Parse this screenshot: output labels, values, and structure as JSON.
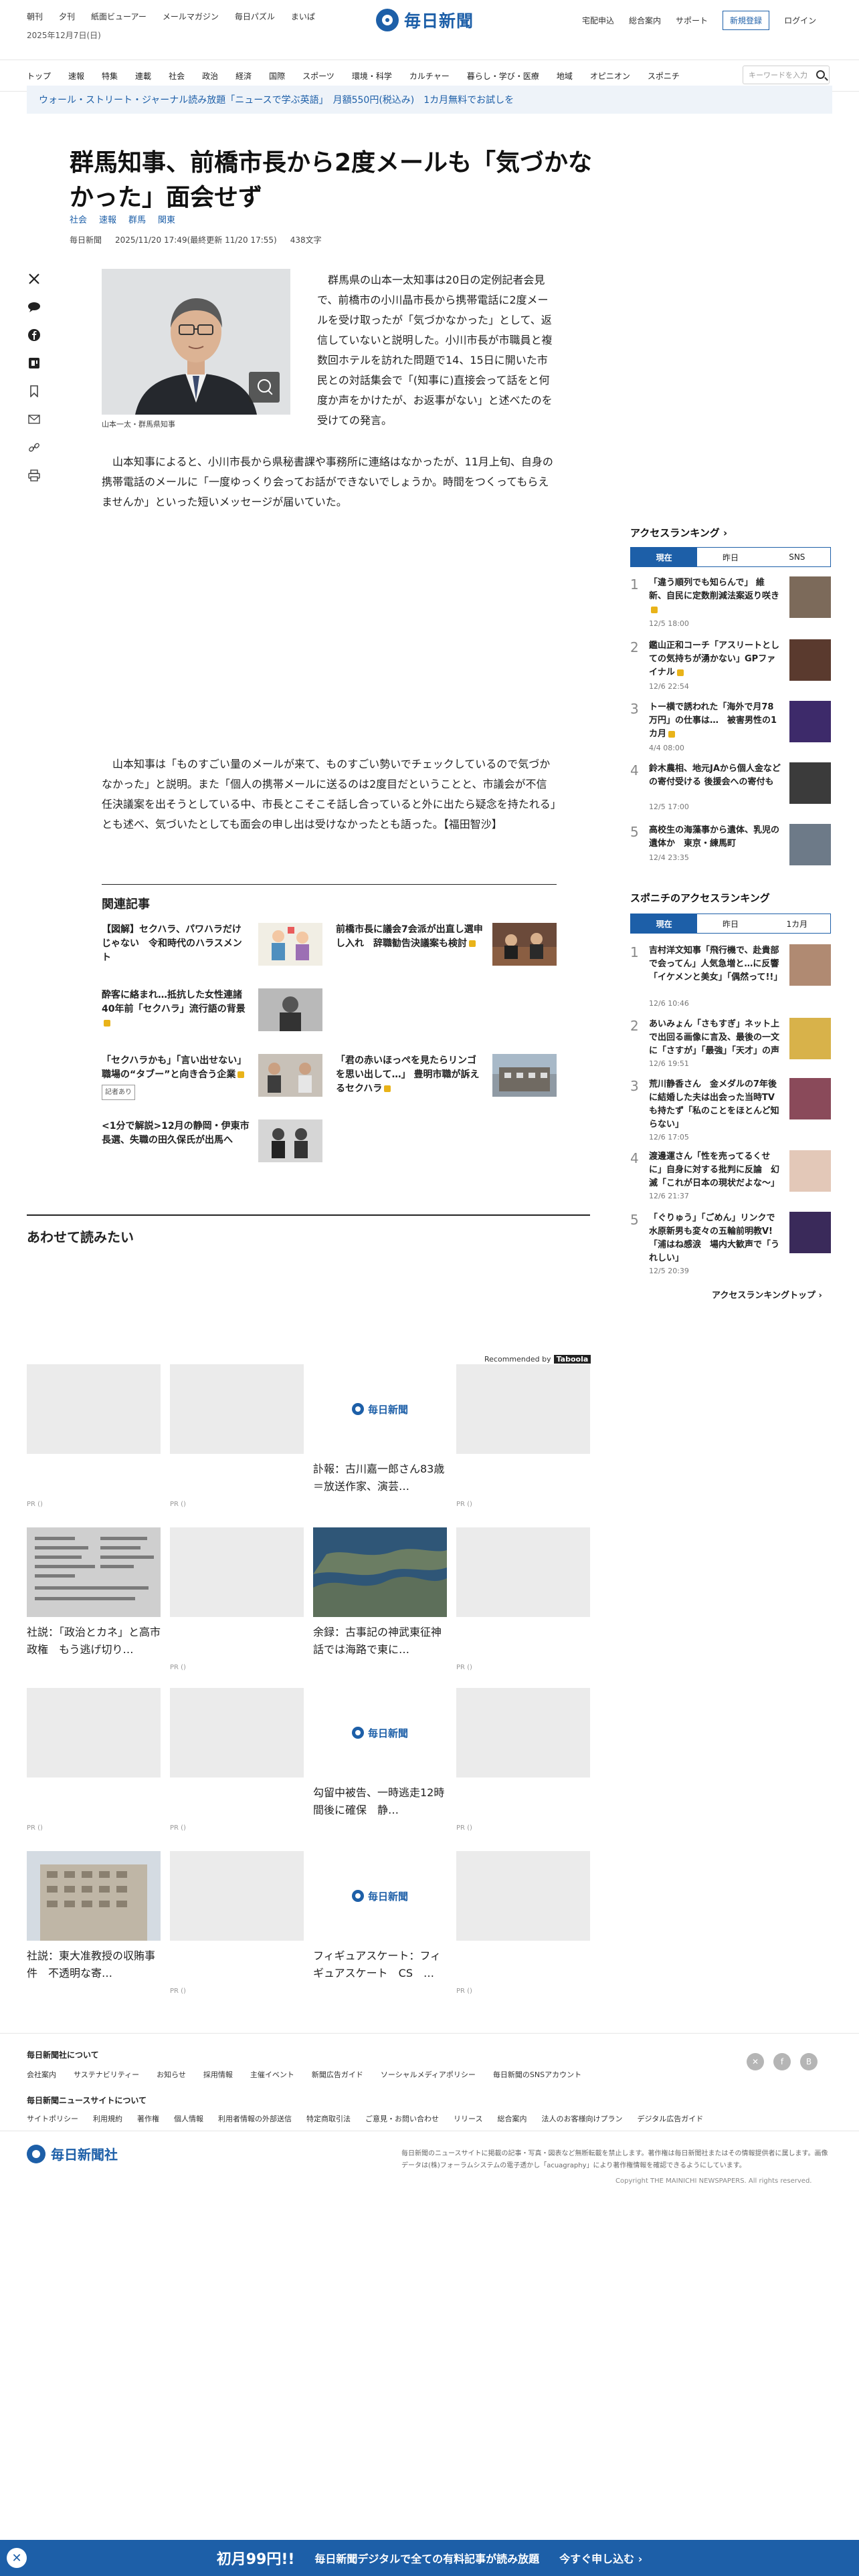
{
  "top": {
    "links": [
      "朝刊",
      "夕刊",
      "紙面ビューアー",
      "メールマガジン",
      "毎日パズル",
      "まいぱ"
    ],
    "date": "2025年12月7日(日)",
    "logo": "毎日新聞",
    "right_links": [
      "宅配申込",
      "総合案内",
      "サポート"
    ],
    "register": "新規登録",
    "login": "ログイン"
  },
  "nav": {
    "items": [
      "トップ",
      "速報",
      "特集",
      "連載",
      "社会",
      "政治",
      "経済",
      "国際",
      "スポーツ",
      "環境・科学",
      "カルチャー",
      "暮らし・学び・医療",
      "地域",
      "オピニオン",
      "スポニチ"
    ],
    "search_placeholder": "キーワードを入力"
  },
  "promo": "ウォール・ストリート・ジャーナル読み放題「ニュースで学ぶ英語」　月額550円(税込み)　1カ月無料でお試しを",
  "article": {
    "headline": "群馬知事、前橋市長から2度メールも「気づかなかった」面会せず",
    "tags": [
      "社会",
      "速報",
      "群馬",
      "関東"
    ],
    "meta": [
      "毎日新聞",
      "2025/11/20 17:49(最終更新 11/20 17:55)",
      "438文字"
    ],
    "caption": "山本一太・群馬県知事",
    "p1": "群馬県の山本一太知事は20日の定例記者会見で、前橋市の小川晶市長から携帯電話に2度メールを受け取ったが「気づかなかった」として、返信していないと説明した。小川市長が市職員と複数回ホテルを訪れた問題で14、15日に開いた市民との対話集会で「(知事に)直接会って話をと何度か声をかけたが、お返事がない」と述べたのを受けての発言。",
    "p2": "山本知事によると、小川市長から県秘書課や事務所に連絡はなかったが、11月上旬、自身の携帯電話のメールに「一度ゆっくり会ってお話ができないでしょうか。時間をつくってもらえませんか」といった短いメッセージが届いていた。",
    "p3": "山本知事は「ものすごい量のメールが来て、ものすごい勢いでチェックしているので気づかなかった」と説明。また「個人の携帯メールに送るのは2度目だということと、市議会が不信任決議案を出そうとしている中、市長とこそこそ話し合っていると外に出たら疑念を持たれる」とも述べ、気づいたとしても面会の申し出は受けなかったとも語った。【福田智沙】"
  },
  "related": {
    "title": "関連記事",
    "items": [
      {
        "text": "【図解】セクハラ、パワハラだけじゃない　令和時代のハラスメント",
        "locked": false,
        "badge": ""
      },
      {
        "text": "前橋市長に議会7会派が出直し選申し入れ　辞職勧告決議案も検討",
        "locked": true,
        "badge": ""
      },
      {
        "text": "酔客に絡まれ…抵抗した女性連諸　40年前「セクハラ」流行語の背景",
        "locked": true,
        "badge": ""
      },
      {
        "text": "「セクハラかも」「言い出せない」職場の“タブー”と向き合う企業",
        "locked": true,
        "badge": "記者あり"
      },
      {
        "text": "「君の赤いほっぺを見たらリンゴを思い出して…」 豊明市職が訴えるセクハラ",
        "locked": true,
        "badge": ""
      },
      {
        "text": "<1分で解説>12月の静岡・伊東市長選、失職の田久保氏が出馬へ",
        "locked": false,
        "badge": ""
      }
    ]
  },
  "read_together": {
    "title": "あわせて読みたい",
    "recommended": "Recommended by",
    "brand": "Taboola",
    "cards": [
      {
        "cap": "",
        "pr": "PR ()"
      },
      {
        "cap": "",
        "pr": "PR ()"
      },
      {
        "cap": "訃報：古川嘉一郎さん83歳＝放送作家、演芸…",
        "pr": ""
      },
      {
        "cap": "",
        "pr": "PR ()"
      },
      {
        "cap": "社説：「政治とカネ」と高市政権　もう逃げ切り…",
        "pr": ""
      },
      {
        "cap": "",
        "pr": "PR ()"
      },
      {
        "cap": "余録：古事記の神武東征神話では海路で東に…",
        "pr": ""
      },
      {
        "cap": "",
        "pr": "PR ()"
      },
      {
        "cap": "",
        "pr": "PR ()"
      },
      {
        "cap": "",
        "pr": "PR ()"
      },
      {
        "cap": "勾留中被告、一時逃走12時間後に確保　静…",
        "pr": ""
      },
      {
        "cap": "",
        "pr": "PR ()"
      },
      {
        "cap": "社説：東大准教授の収賄事件　不透明な寄…",
        "pr": ""
      },
      {
        "cap": "",
        "pr": "PR ()"
      },
      {
        "cap": "フィギュアスケート：フィギュアスケート　CS　…",
        "pr": ""
      },
      {
        "cap": "",
        "pr": "PR ()"
      }
    ]
  },
  "sidebar": {
    "ranking_title": "アクセスランキング",
    "tabs": [
      "現在",
      "昨日",
      "SNS"
    ],
    "items": [
      {
        "n": "1",
        "t": "「違う順列でも知らんで」 維新、自民に定数削減法案返り咲き",
        "d": "12/5 18:00"
      },
      {
        "n": "2",
        "t": "鑑山正和コーチ「アスリートとしての気持ちが湧かない」GPファイナル",
        "d": "12/6 22:54"
      },
      {
        "n": "3",
        "t": "トー横で誘われた「海外で月78万円」の仕事は…　被害男性の1カ月",
        "d": "4/4 08:00"
      },
      {
        "n": "4",
        "t": "鈴木農相、地元JAから個人金などの寄付受ける 後援会への寄付も",
        "d": "12/5 17:00"
      },
      {
        "n": "5",
        "t": "高校生の海藻事から遺体、乳児の遺体か　東京・練馬町",
        "d": "12/4 23:35"
      }
    ],
    "sponichi_title": "スポニチのアクセスランキング",
    "sponichi_tabs": [
      "現在",
      "昨日",
      "1カ月"
    ],
    "sponichi_items": [
      {
        "n": "1",
        "t": "吉村洋文知事「飛行機で、赴貴部で会ってん」人気急増と…に反響「イケメンと美女」「偶然って!!」",
        "d": "12/6 10:46"
      },
      {
        "n": "2",
        "t": "あいみょん「さもすぎ」ネット上で出回る画像に言及、最後の一文に「さすが」「最強」「天才」の声",
        "d": "12/6 19:51"
      },
      {
        "n": "3",
        "t": "荒川静香さん　金メダルの7年後に結婚した夫は出会った当時TVも持たず「私のことをほとんど知らない」",
        "d": "12/6 17:05"
      },
      {
        "n": "4",
        "t": "渡邊運さん「性を売ってるくせに」自身に対する批判に反論　幻滅「これが日本の現状だよな～」",
        "d": "12/6 21:37"
      },
      {
        "n": "5",
        "t": "「ぐりゅう」「ごめん」リンクで水原新男も変々の五輪前明教V!「浦はね感涙　場内大歓声で「うれしい」",
        "d": "12/5 20:39"
      }
    ],
    "more": "アクセスランキングトップ"
  },
  "footer": {
    "about_title": "毎日新聞社について",
    "about_links": [
      "会社案内",
      "サステナビリティー",
      "お知らせ",
      "採用情報",
      "主催イベント",
      "新聞広告ガイド",
      "ソーシャルメディアポリシー",
      "毎日新聞のSNSアカウント"
    ],
    "site_title": "毎日新聞ニュースサイトについて",
    "site_links": [
      "サイトポリシー",
      "利用規約",
      "著作権",
      "個人情報",
      "利用者情報の外部送信",
      "特定商取引法",
      "ご意見・お問い合わせ",
      "リリース",
      "総合案内",
      "法人のお客様向けプラン",
      "デジタル広告ガイド"
    ],
    "company_logo": "毎日新聞社",
    "note": "毎日新聞のニュースサイトに掲載の記事・写真・図表など無断転載を禁止します。著作権は毎日新聞社またはその情報提供者に属します。画像データは(株)フォーラムシステムの電子透かし「acuagraphy」により著作権情報を確認できるようにしています。",
    "copyright": "Copyright THE MAINICHI NEWSPAPERS. All rights reserved."
  },
  "banner": {
    "price": "初月99円!!",
    "text": "毎日新聞デジタルで全ての有料記事が読み放題",
    "cta": "今すぐ申し込む"
  }
}
